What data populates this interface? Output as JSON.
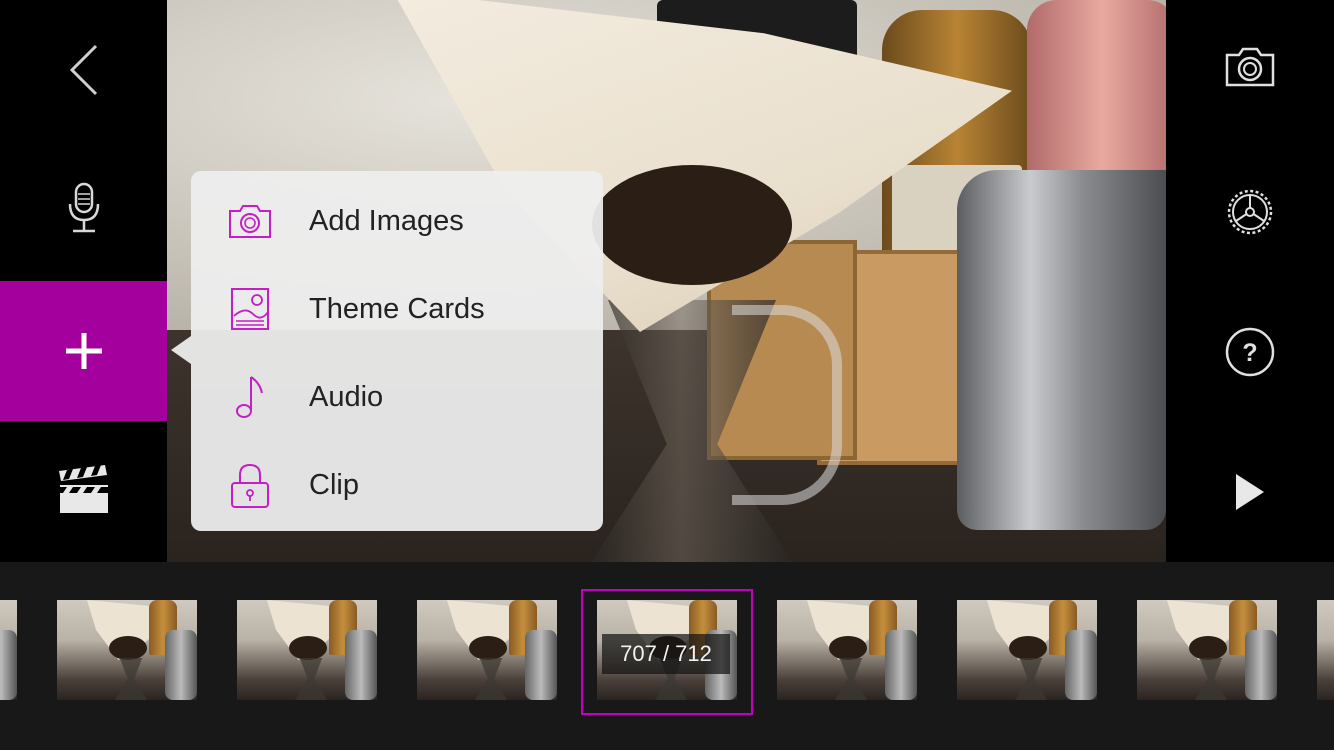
{
  "left_toolbar": {
    "back_icon": "chevron-left-icon",
    "voiceover_icon": "microphone-icon",
    "add_icon": "plus-icon",
    "project_icon": "clapperboard-icon",
    "accent_color": "#a3009e"
  },
  "right_toolbar": {
    "camera_icon": "camera-icon",
    "settings_icon": "gear-icon",
    "help_icon": "question-icon",
    "help_glyph": "?",
    "play_icon": "play-icon"
  },
  "add_menu": {
    "items": [
      {
        "label": "Add Images",
        "icon": "camera-icon"
      },
      {
        "label": "Theme Cards",
        "icon": "theme-card-icon"
      },
      {
        "label": "Audio",
        "icon": "music-note-icon"
      },
      {
        "label": "Clip",
        "icon": "lock-icon"
      }
    ],
    "icon_color": "#c41fc4"
  },
  "timeline": {
    "frame_counter": "707 / 712",
    "selection_color": "#c400c0"
  }
}
